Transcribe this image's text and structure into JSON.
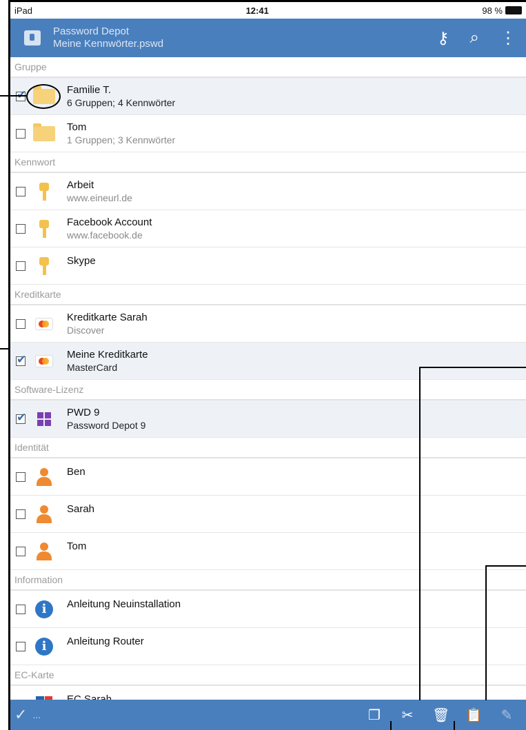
{
  "status": {
    "device": "iPad",
    "time": "12:41",
    "battery": "98 %"
  },
  "app": {
    "title": "Password Depot",
    "file": "Meine Kennwörter.pswd"
  },
  "sections": [
    {
      "label": "Gruppe",
      "rows": [
        {
          "icon": "folder-icon",
          "checked": true,
          "title": "Familie T.",
          "subtitle": "6 Gruppen; 4 Kennwörter"
        },
        {
          "icon": "folder-icon",
          "checked": false,
          "title": "Tom",
          "subtitle": "1 Gruppen; 3 Kennwörter"
        }
      ]
    },
    {
      "label": "Kennwort",
      "rows": [
        {
          "icon": "key-icon",
          "checked": false,
          "title": "Arbeit",
          "subtitle": "www.eineurl.de"
        },
        {
          "icon": "key-icon",
          "checked": false,
          "title": "Facebook Account",
          "subtitle": "www.facebook.de"
        },
        {
          "icon": "key-icon",
          "checked": false,
          "title": "Skype",
          "subtitle": ""
        }
      ]
    },
    {
      "label": "Kreditkarte",
      "rows": [
        {
          "icon": "credit-card-icon",
          "checked": false,
          "title": "Kreditkarte Sarah",
          "subtitle": "Discover"
        },
        {
          "icon": "credit-card-icon",
          "checked": true,
          "title": "Meine Kreditkarte",
          "subtitle": "MasterCard"
        }
      ]
    },
    {
      "label": "Software-Lizenz",
      "rows": [
        {
          "icon": "windows-icon",
          "checked": true,
          "title": "PWD 9",
          "subtitle": "Password Depot 9"
        }
      ]
    },
    {
      "label": "Identität",
      "rows": [
        {
          "icon": "person-icon",
          "checked": false,
          "title": "Ben",
          "subtitle": ""
        },
        {
          "icon": "person-icon",
          "checked": false,
          "title": "Sarah",
          "subtitle": ""
        },
        {
          "icon": "person-icon",
          "checked": false,
          "title": "Tom",
          "subtitle": ""
        }
      ]
    },
    {
      "label": "Information",
      "rows": [
        {
          "icon": "info-icon",
          "checked": false,
          "title": "Anleitung Neuinstallation",
          "subtitle": ""
        },
        {
          "icon": "info-icon",
          "checked": false,
          "title": "Anleitung Router",
          "subtitle": ""
        }
      ]
    },
    {
      "label": "EC-Karte",
      "rows": [
        {
          "icon": "ec-card-icon",
          "checked": false,
          "title": "EC Sarah",
          "subtitle": ""
        }
      ]
    }
  ],
  "bottom": {
    "done": "✓",
    "more": "..."
  }
}
